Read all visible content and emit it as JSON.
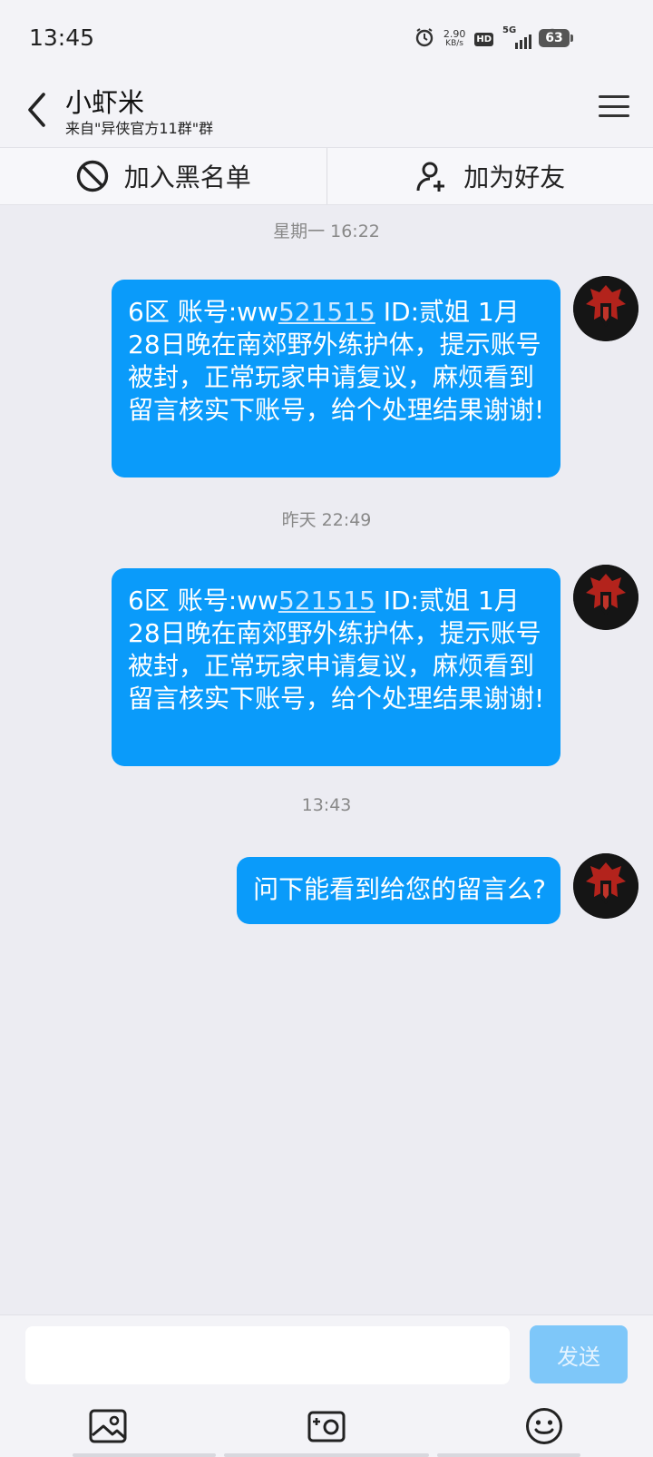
{
  "status_bar": {
    "time": "13:45",
    "net_speed": "2.90",
    "net_unit": "KB/s",
    "hd_label": "HD",
    "network": "5G",
    "battery": "63",
    "icons": [
      "alarm-icon",
      "hd-icon",
      "signal-icon",
      "wifi-icon",
      "battery-icon"
    ]
  },
  "header": {
    "name": "小虾米",
    "source": "来自\"异侠官方11群\"群"
  },
  "actions": {
    "block_label": "加入黑名单",
    "add_friend_label": "加为好友"
  },
  "messages": [
    {
      "timestamp": "星期一 16:22",
      "text_before": "6区  账号:ww",
      "link": "521515",
      "text_after": "  ID:贰姐  1月28日晚在南郊野外练护体，提示账号被封，正常玩家申请复议，麻烦看到留言核实下账号，给个处理结果谢谢!"
    },
    {
      "timestamp": "昨天 22:49",
      "text_before": "6区  账号:ww",
      "link": "521515",
      "text_after": "  ID:贰姐  1月28日晚在南郊野外练护体，提示账号被封，正常玩家申请复议，麻烦看到留言核实下账号，给个处理结果谢谢!"
    },
    {
      "timestamp": "13:43",
      "text_before": "问下能看到给您的留言么?",
      "link": "",
      "text_after": ""
    }
  ],
  "input": {
    "placeholder": "",
    "value": "",
    "send_label": "发送"
  },
  "colors": {
    "bubble": "#0a9bfa",
    "send_disabled": "#7ec7f9",
    "background": "#ececf2"
  }
}
